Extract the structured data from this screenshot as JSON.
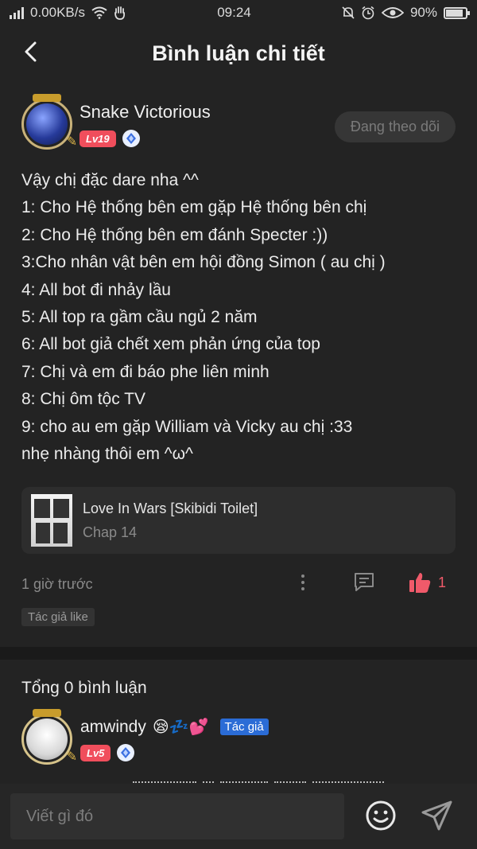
{
  "status": {
    "speed": "0.00KB/s",
    "time": "09:24",
    "battery": "90%"
  },
  "header": {
    "title": "Bình luận chi tiết"
  },
  "comment": {
    "username": "Snake Victorious",
    "level": "Lv19",
    "follow_label": "Đang theo dõi",
    "lines": [
      "Vậy chị đặc dare nha ^^",
      "1: Cho Hệ thống bên em gặp Hệ thống bên chị",
      "2: Cho Hệ thống bên em đánh Specter :))",
      "3:Cho nhân vật bên em hội đồng Simon ( au chị )",
      "4: All bot đi nhảy lầu",
      "5: All top ra gầm cầu ngủ 2 năm",
      "6: All bot giả chết xem phản ứng của top",
      "7: Chị và em đi báo phe liên minh",
      "8: Chị ôm tộc TV",
      "9: cho au em gặp William và Vicky au chị :33",
      "nhẹ nhàng thôi em ^ω^"
    ],
    "chapter_title": "Love In Wars [Skibidi Toilet]",
    "chapter_sub": "Chap 14",
    "time": "1 giờ trước",
    "like_count": "1",
    "author_like": "Tác giả like"
  },
  "replies": {
    "total": "Tổng 0 bình luận",
    "first": {
      "username": "amwindy",
      "emojis": "😪💤💕",
      "author_tag": "Tác giả",
      "level": "Lv5"
    }
  },
  "composer": {
    "placeholder": "Viết gì đó"
  },
  "colors": {
    "background": "#232323",
    "accent_like": "#f05a6a",
    "level_badge": "#f04e5c",
    "author_tag": "#2b6cd6"
  }
}
